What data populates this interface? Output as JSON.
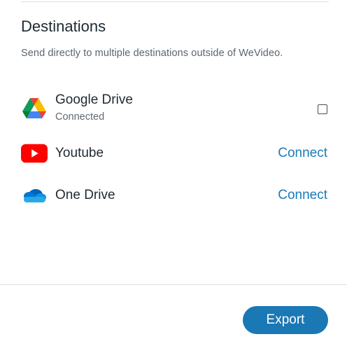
{
  "destinations": {
    "heading": "Destinations",
    "description": "Send directly to multiple destinations outside of WeVideo.",
    "items": [
      {
        "name": "Google Drive",
        "status": "Connected",
        "icon": "google-drive-icon",
        "checked": false
      },
      {
        "name": "Youtube",
        "action": "Connect",
        "icon": "youtube-icon"
      },
      {
        "name": "One Drive",
        "action": "Connect",
        "icon": "onedrive-icon"
      }
    ]
  },
  "footer": {
    "export_label": "Export"
  },
  "colors": {
    "accent": "#1a78b4",
    "link": "#1a7bb8",
    "youtube_red": "#ff0000",
    "onedrive_blue": "#0f78d4"
  }
}
